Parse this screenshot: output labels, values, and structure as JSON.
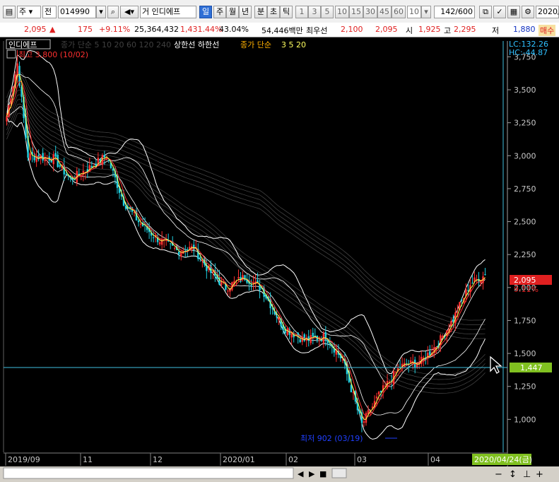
{
  "toolbar": {
    "item_type": "주",
    "adj": "전",
    "code": "014990",
    "name_prefix": "거",
    "stock_name": "인디에프",
    "periods": [
      "일",
      "주",
      "월",
      "년"
    ],
    "period_selected": "일",
    "intraday": [
      "분",
      "초",
      "틱"
    ],
    "intervals": [
      "1",
      "3",
      "5",
      "10",
      "15",
      "30",
      "45",
      "60"
    ],
    "interval_value": "10",
    "count": "142",
    "count_total": "/600",
    "date": "2020/"
  },
  "info": {
    "price": "2,095",
    "up_arrow": "▲",
    "change": "175",
    "change_pct": "+9.11%",
    "volume": "25,364,432",
    "volume_pct": "1,431.44%",
    "turnover": "43.04%",
    "amount": "54,446백만",
    "best_label": "최우선",
    "best_ask": "2,100",
    "best_bid": "2,095",
    "open_label": "시",
    "open": "1,925",
    "high_label": "고",
    "high": "2,295",
    "low_label": "저",
    "low": "1,880",
    "extra": "매수"
  },
  "chart": {
    "stock_tab": "인디에프",
    "legend_ma": "종가 단순 5  10  20  60  120  240",
    "legend_envelope": "상한선  하한선",
    "legend_ma2_label": "종가 단순",
    "legend_ma2_values": "3  5  20",
    "high_marker": "최고 3,800 (10/02)",
    "low_marker": "최저 902 (03/19)",
    "lc_label": "LC:132.26",
    "hc_label": "HC:-44.87",
    "current_price_tag": "2,095",
    "current_pct_tag": "9.11%",
    "crosshair_price_tag": "1,447",
    "crosshair_date_tag": "2020/04/24(금)"
  },
  "chart_data": {
    "type": "candlestick",
    "y_axis": [
      "3,750",
      "3,500",
      "3,250",
      "3,000",
      "2,750",
      "2,500",
      "2,250",
      "2,000",
      "1,750",
      "1,500",
      "1,250",
      "1,000"
    ],
    "ylim": [
      750,
      3870
    ],
    "x_axis": [
      "2019/09",
      "11",
      "12",
      "2020/01",
      "02",
      "03",
      "04"
    ],
    "last_close": 2095,
    "period_high": 3800,
    "period_low": 902
  },
  "colors": {
    "background": "#000000",
    "up": "#ff3030",
    "down": "#20d0e0",
    "ma_short": "#ffff50",
    "bollinger": "#ffffff",
    "crosshair": "#40c0e0",
    "price_tag": "#e02020",
    "cross_tag": "#80c020"
  }
}
